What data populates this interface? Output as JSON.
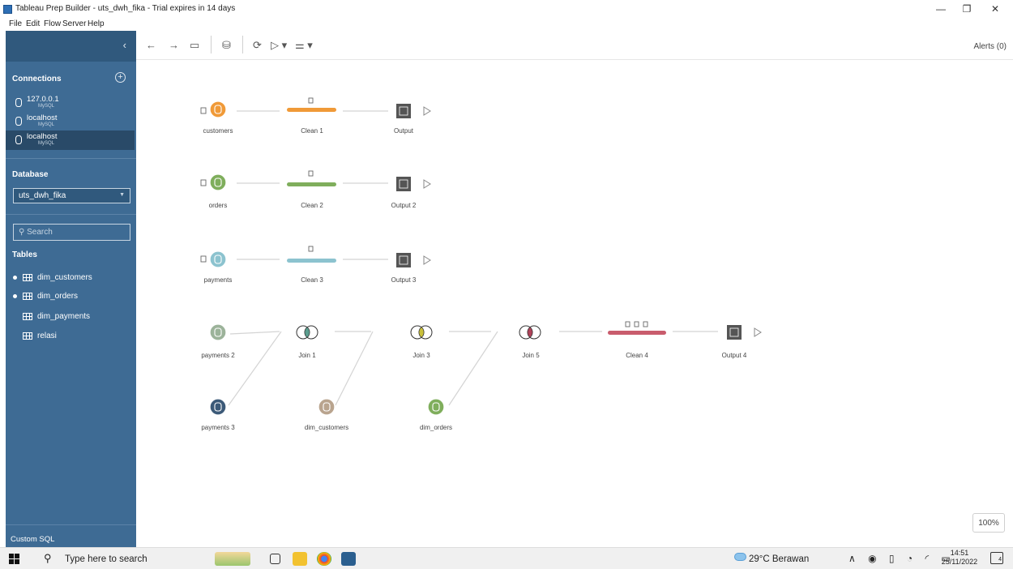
{
  "window": {
    "title": "Tableau Prep Builder - uts_dwh_fika - Trial expires in 14 days",
    "minimize": "—",
    "maximize": "❐",
    "close": "✕"
  },
  "menu": [
    "File",
    "Edit",
    "Flow",
    "Server",
    "Help"
  ],
  "sidebar": {
    "collapse": "‹",
    "connections_header": "Connections",
    "add": "+",
    "connections": [
      {
        "name": "127.0.0.1",
        "type": "MySQL"
      },
      {
        "name": "localhost",
        "type": "MySQL"
      },
      {
        "name": "localhost",
        "type": "MySQL",
        "selected": true
      }
    ],
    "database_header": "Database",
    "database_value": "uts_dwh_fika",
    "search_placeholder": "Search",
    "tables_header": "Tables",
    "tables": [
      {
        "name": "dim_customers",
        "used": true
      },
      {
        "name": "dim_orders",
        "used": true
      },
      {
        "name": "dim_payments",
        "used": false
      },
      {
        "name": "relasi",
        "used": false
      }
    ],
    "custom_sql": "Custom SQL"
  },
  "toolbar": {
    "back": "←",
    "forward": "→",
    "save": "▭",
    "data": "⛁",
    "refresh": "⟳",
    "run": "▷ ▾",
    "filter": "⚌ ▾",
    "alerts": "Alerts (0)"
  },
  "flow": {
    "nodes": {
      "customers": "customers",
      "clean1": "Clean 1",
      "output": "Output",
      "orders": "orders",
      "clean2": "Clean 2",
      "output2": "Output 2",
      "payments": "payments",
      "clean3": "Clean 3",
      "output3": "Output 3",
      "payments2": "payments 2",
      "payments3": "payments 3",
      "join1": "Join 1",
      "dimcust": "dim_customers",
      "join3": "Join 3",
      "dimorders": "dim_orders",
      "join5": "Join 5",
      "clean4": "Clean 4",
      "output4": "Output 4"
    },
    "colors": {
      "orange": "#f09a38",
      "green": "#7fae5c",
      "teal": "#8cc3cf",
      "sage": "#9cb39a",
      "navy": "#3c5a78",
      "tan": "#b9a48e",
      "pink": "#c95c6d"
    }
  },
  "zoom": "100%",
  "taskbar": {
    "search": "Type here to search",
    "weather": "29°C  Berawan",
    "time": "14:51",
    "date": "25/11/2022",
    "notifications": "4",
    "tray": "∧ ◉ ▯ ◔ ◜ ▭"
  }
}
